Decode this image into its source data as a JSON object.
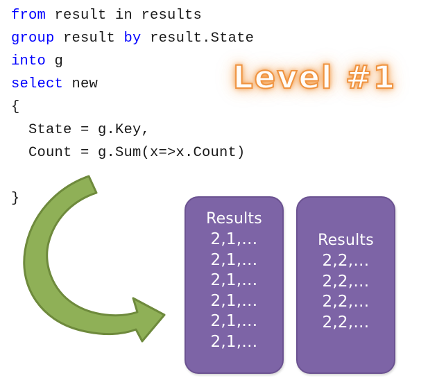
{
  "code": {
    "font_color_keyword": "#0000ff",
    "font_color_plain": "#1a1a1a",
    "lines": [
      [
        {
          "t": "from",
          "k": true
        },
        {
          "t": " result in results",
          "k": false
        }
      ],
      [
        {
          "t": "group",
          "k": true
        },
        {
          "t": " result ",
          "k": false
        },
        {
          "t": "by",
          "k": true
        },
        {
          "t": " result.State",
          "k": false
        }
      ],
      [
        {
          "t": "into",
          "k": true
        },
        {
          "t": " g",
          "k": false
        }
      ],
      [
        {
          "t": "select",
          "k": true
        },
        {
          "t": " new",
          "k": false
        }
      ],
      [
        {
          "t": "{",
          "k": false
        }
      ],
      [
        {
          "t": "  State = g.Key,",
          "k": false
        }
      ],
      [
        {
          "t": "  Count = g.Sum(x=>x.Count)",
          "k": false
        }
      ],
      [
        {
          "t": "",
          "k": false
        }
      ],
      [
        {
          "t": "}",
          "k": false
        }
      ]
    ]
  },
  "level_title": {
    "text": "Level #1",
    "fill_color": "#fffdfa",
    "outline_color": "#ef9340",
    "glow_color": "#f3963c"
  },
  "arrow": {
    "fill_color": "#8fb057",
    "stroke_color": "#6e8a3c",
    "direction": "curved-left-down-right"
  },
  "boxes": [
    {
      "id": "results-box-1",
      "title": "Results",
      "rows": [
        "2,1,…",
        "2,1,…",
        "2,1,…",
        "2,1,…",
        "2,1,…",
        "2,1,…"
      ],
      "fill_color": "#7d64a6",
      "border_color": "#6b5291",
      "text_color": "#ffffff"
    },
    {
      "id": "results-box-2",
      "title": "Results",
      "rows": [
        "2,2,…",
        "2,2,…",
        "2,2,…",
        "2,2,…"
      ],
      "fill_color": "#7d64a6",
      "border_color": "#6b5291",
      "text_color": "#ffffff"
    }
  ]
}
